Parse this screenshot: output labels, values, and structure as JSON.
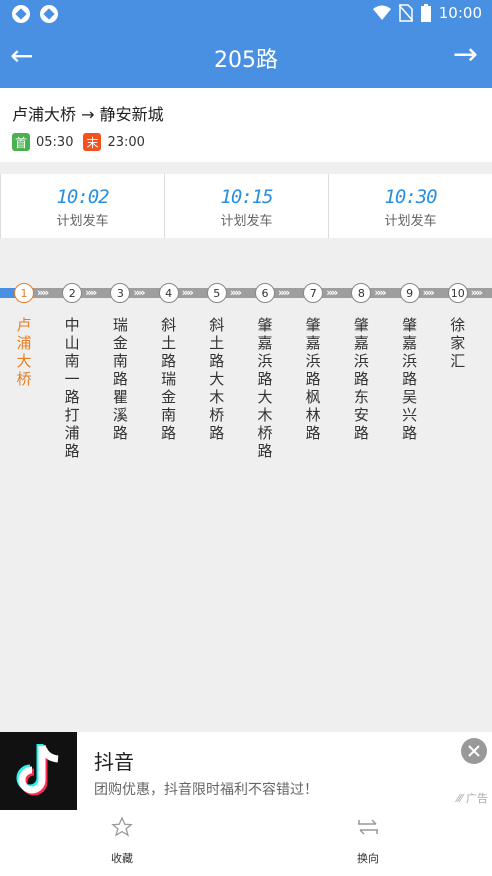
{
  "status": {
    "time": "10:00"
  },
  "header": {
    "title": "205路"
  },
  "route": {
    "from_to": "卢浦大桥 → 静安新城",
    "first_tag": "首",
    "first_time": "05:30",
    "last_tag": "末",
    "last_time": "23:00"
  },
  "schedule": [
    {
      "time": "10:02",
      "label": "计划发车"
    },
    {
      "time": "10:15",
      "label": "计划发车"
    },
    {
      "time": "10:30",
      "label": "计划发车"
    }
  ],
  "stops": [
    {
      "num": "1",
      "name": "卢浦大桥"
    },
    {
      "num": "2",
      "name": "中山南一路打浦路"
    },
    {
      "num": "3",
      "name": "瑞金南路瞿溪路"
    },
    {
      "num": "4",
      "name": "斜土路瑞金南路"
    },
    {
      "num": "5",
      "name": "斜土路大木桥路"
    },
    {
      "num": "6",
      "name": "肇嘉浜路大木桥路"
    },
    {
      "num": "7",
      "name": "肇嘉浜路枫林路"
    },
    {
      "num": "8",
      "name": "肇嘉浜路东安路"
    },
    {
      "num": "9",
      "name": "肇嘉浜路吴兴路"
    },
    {
      "num": "10",
      "name": "徐家汇"
    }
  ],
  "ad": {
    "name": "抖音",
    "desc": "团购优惠，抖音限时福利不容错过！",
    "label": "广告"
  },
  "bottom": {
    "favorite": "收藏",
    "reverse": "换向"
  },
  "colors": {
    "primary": "#4a90e2",
    "current": "#e67e22",
    "first": "#4caf50",
    "last": "#f4511e"
  }
}
